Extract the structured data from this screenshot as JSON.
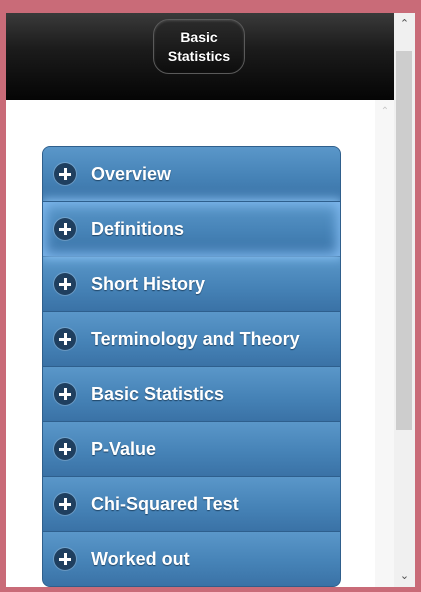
{
  "header": {
    "title": "Basic\nStatistics"
  },
  "menu": {
    "items": [
      {
        "label": "Overview"
      },
      {
        "label": "Definitions",
        "focused": true
      },
      {
        "label": "Short History"
      },
      {
        "label": "Terminology and Theory"
      },
      {
        "label": "Basic Statistics"
      },
      {
        "label": "P-Value"
      },
      {
        "label": "Chi-Squared Test"
      },
      {
        "label": "Worked out"
      }
    ]
  },
  "colors": {
    "accent": "#4683b7",
    "header": "#111111",
    "frame": "#c96b78"
  },
  "icons": {
    "expand": "plus-circle-icon",
    "scroll_up": "chevron-up-icon",
    "scroll_down": "chevron-down-icon"
  }
}
